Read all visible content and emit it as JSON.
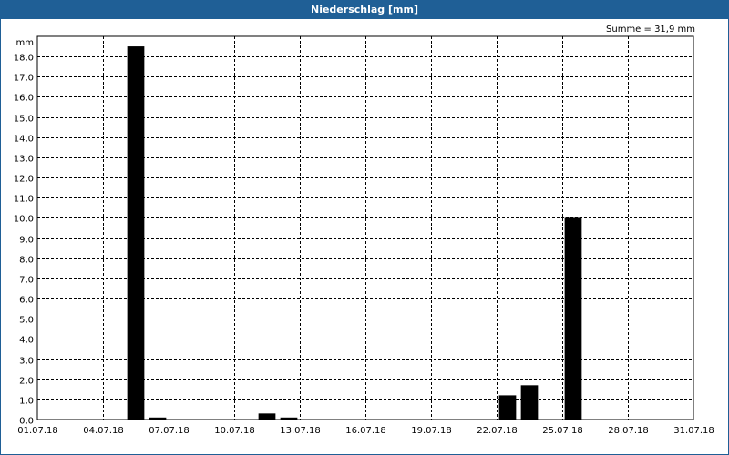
{
  "window": {
    "title": "Niederschlag [mm]"
  },
  "summary": {
    "text": "Summe = 31,9 mm"
  },
  "chart_data": {
    "type": "bar",
    "title": "Niederschlag [mm]",
    "ylabel": "mm",
    "xlabel": "",
    "ylim": [
      0,
      19
    ],
    "grid": true,
    "x_range": [
      "01.07.18",
      "31.07.18"
    ],
    "x_ticks": [
      "01.07.18",
      "04.07.18",
      "07.07.18",
      "10.07.18",
      "13.07.18",
      "16.07.18",
      "19.07.18",
      "22.07.18",
      "25.07.18",
      "28.07.18",
      "31.07.18"
    ],
    "y_ticks": [
      "0,0",
      "1,0",
      "2,0",
      "3,0",
      "4,0",
      "5,0",
      "6,0",
      "7,0",
      "8,0",
      "9,0",
      "10,0",
      "11,0",
      "12,0",
      "13,0",
      "14,0",
      "15,0",
      "16,0",
      "17,0",
      "18,0"
    ],
    "categories": [
      "05.07.18",
      "06.07.18",
      "11.07.18",
      "12.07.18",
      "22.07.18",
      "23.07.18",
      "25.07.18"
    ],
    "values": [
      18.5,
      0.1,
      0.3,
      0.1,
      1.2,
      1.7,
      10.0
    ],
    "bar_color": "#000000",
    "grid_color": "#000000"
  }
}
